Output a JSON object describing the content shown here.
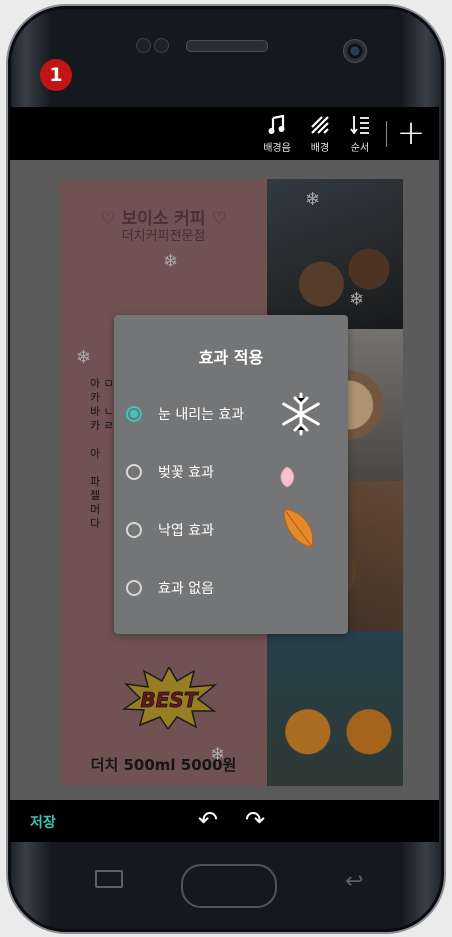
{
  "step_badge": "1",
  "toolbar": {
    "music_label": "배경음",
    "background_label": "배경",
    "order_label": "순서",
    "add_label": "+"
  },
  "card": {
    "title": "♡ 보이소 커피 ♡",
    "subtitle": "더치커피전문점",
    "menu_lines": [
      "아 ㅁ",
      "카",
      "바 ㄴ",
      "카 ㄹ",
      "",
      "아",
      "",
      "파",
      "젤",
      "머",
      "다"
    ],
    "best_label": "BEST",
    "price": "더치 500ml 5000원"
  },
  "dialog": {
    "title": "효과 적용",
    "options": [
      {
        "label": "눈 내리는 효과",
        "selected": true,
        "art": "snowflake-icon"
      },
      {
        "label": "벚꽃 효과",
        "selected": false,
        "art": "cherry-petal-icon"
      },
      {
        "label": "낙엽 효과",
        "selected": false,
        "art": "leaf-icon"
      },
      {
        "label": "효과 없음",
        "selected": false,
        "art": ""
      }
    ]
  },
  "bottombar": {
    "save_label": "저장"
  },
  "colors": {
    "accent": "#36c8b9",
    "badge": "#c11414",
    "dialog_bg": "#747576"
  }
}
